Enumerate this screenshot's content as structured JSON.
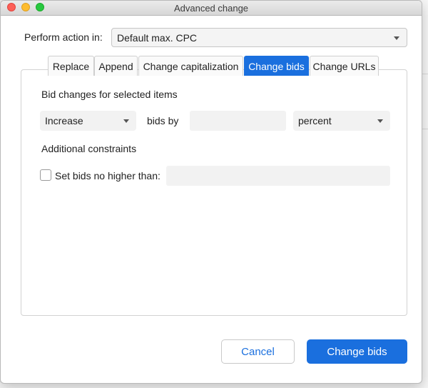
{
  "window": {
    "title": "Advanced change"
  },
  "perform": {
    "label": "Perform action in:",
    "selected": "Default max. CPC"
  },
  "tabs": [
    {
      "label": "Replace",
      "active": false
    },
    {
      "label": "Append",
      "active": false
    },
    {
      "label": "Change capitalization",
      "active": false
    },
    {
      "label": "Change bids",
      "active": true
    },
    {
      "label": "Change URLs",
      "active": false
    }
  ],
  "bid_changes": {
    "heading": "Bid changes for selected items",
    "direction": "Increase",
    "by_label": "bids by",
    "amount": "",
    "unit": "percent"
  },
  "constraints": {
    "heading": "Additional constraints",
    "max_bid_label": "Set bids no higher than:",
    "max_bid_checked": false,
    "max_bid_value": ""
  },
  "buttons": {
    "cancel": "Cancel",
    "primary": "Change bids"
  },
  "colors": {
    "accent": "#1a6fde"
  }
}
